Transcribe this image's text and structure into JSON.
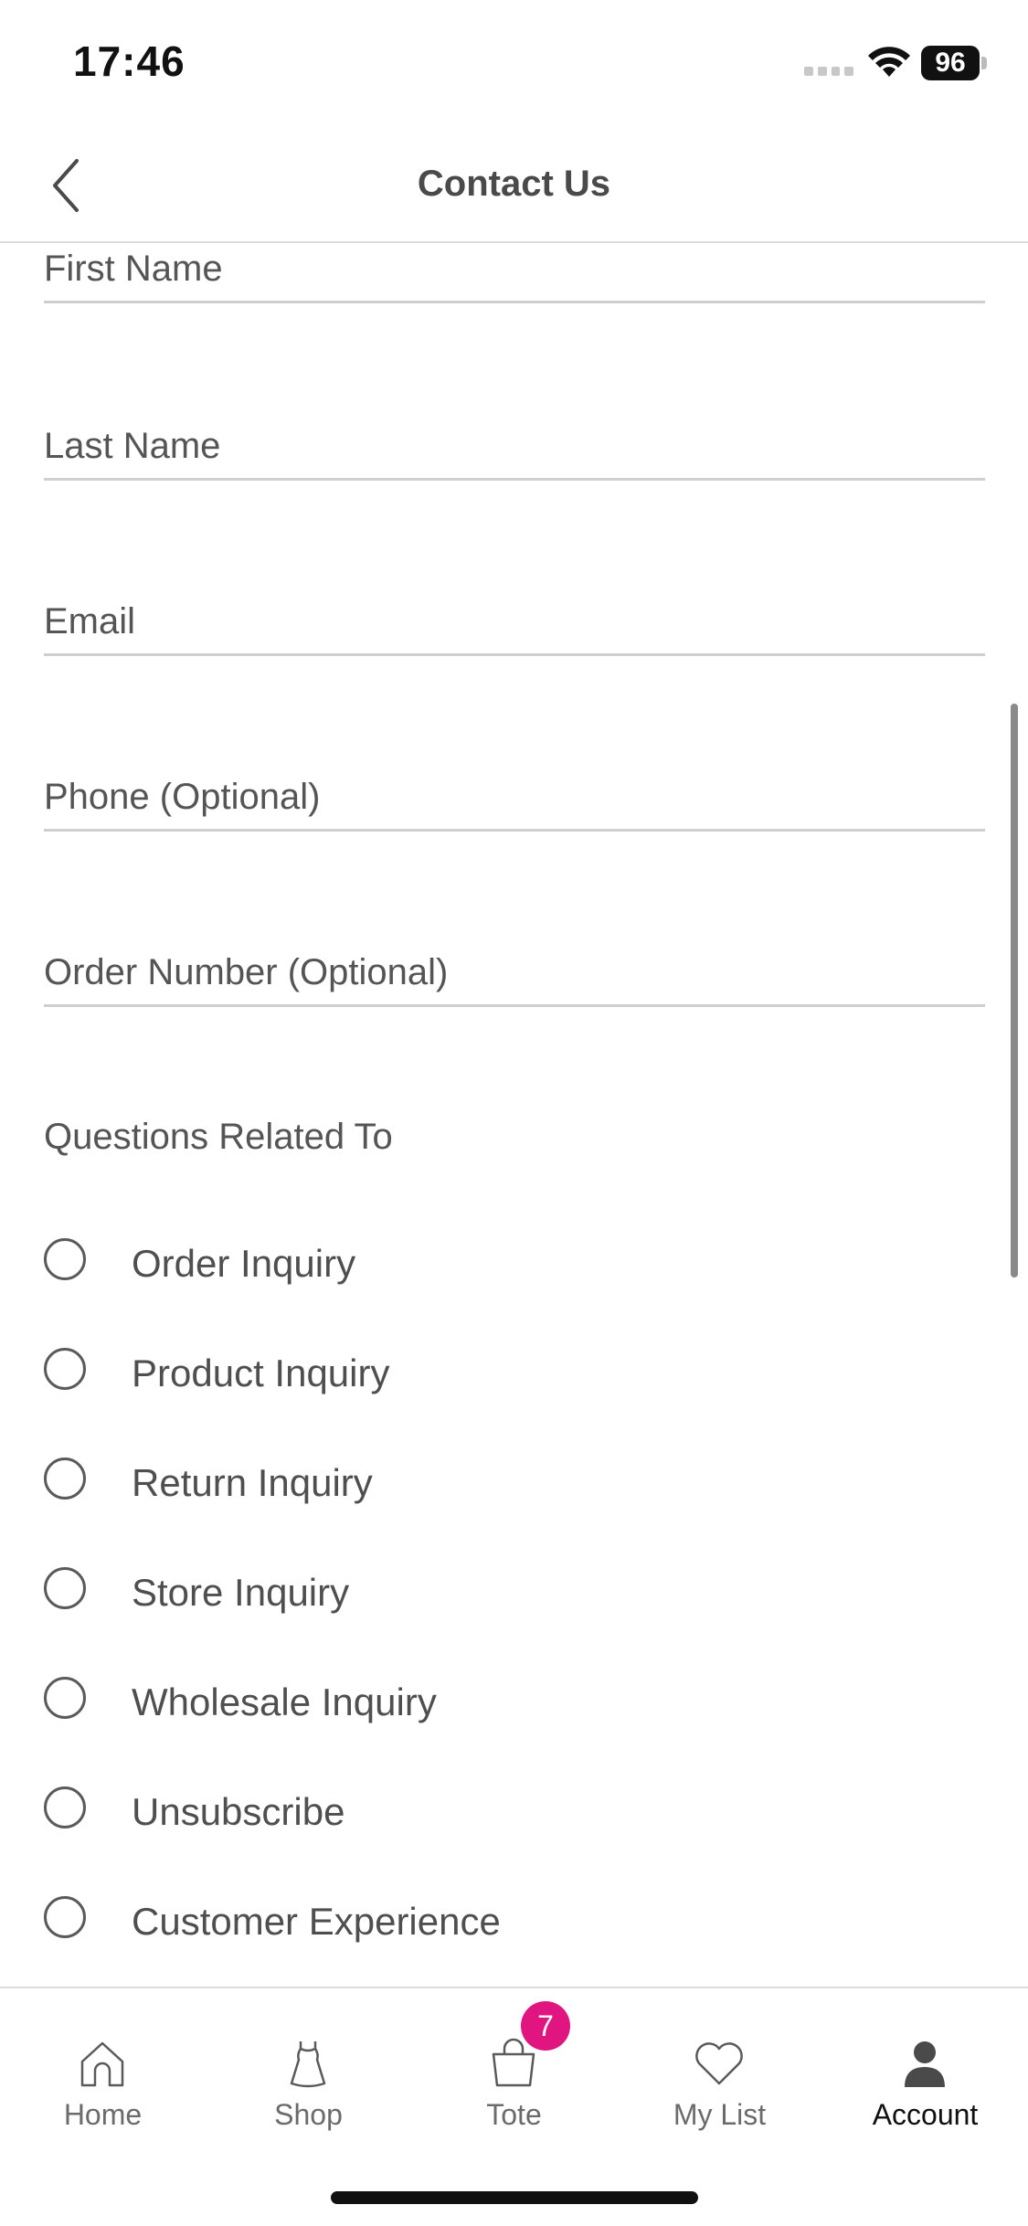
{
  "status_bar": {
    "time": "17:46",
    "battery": "96",
    "icons": [
      "signal-icon",
      "wifi-icon",
      "battery-icon"
    ]
  },
  "header": {
    "title": "Contact Us",
    "back_icon": "chevron-left-icon"
  },
  "form": {
    "fields": [
      {
        "label": "First Name"
      },
      {
        "label": "Last Name"
      },
      {
        "label": "Email"
      },
      {
        "label": "Phone (Optional)"
      },
      {
        "label": "Order Number (Optional)"
      }
    ],
    "questions_title": "Questions Related To",
    "options": [
      {
        "label": "Order Inquiry",
        "selected": false
      },
      {
        "label": "Product Inquiry",
        "selected": false
      },
      {
        "label": "Return Inquiry",
        "selected": false
      },
      {
        "label": "Store Inquiry",
        "selected": false
      },
      {
        "label": "Wholesale Inquiry",
        "selected": false
      },
      {
        "label": "Unsubscribe",
        "selected": false
      },
      {
        "label": "Customer Experience",
        "selected": false
      }
    ]
  },
  "tab_bar": {
    "tabs": [
      {
        "label": "Home",
        "icon": "home-icon"
      },
      {
        "label": "Shop",
        "icon": "dress-icon"
      },
      {
        "label": "Tote",
        "icon": "bag-icon",
        "badge": "7"
      },
      {
        "label": "My List",
        "icon": "heart-icon"
      },
      {
        "label": "Account",
        "icon": "person-icon",
        "active": true
      }
    ]
  },
  "colors": {
    "accent_badge": "#e0157f",
    "text": "#4a4a4a",
    "divider": "#cfcfcf"
  }
}
